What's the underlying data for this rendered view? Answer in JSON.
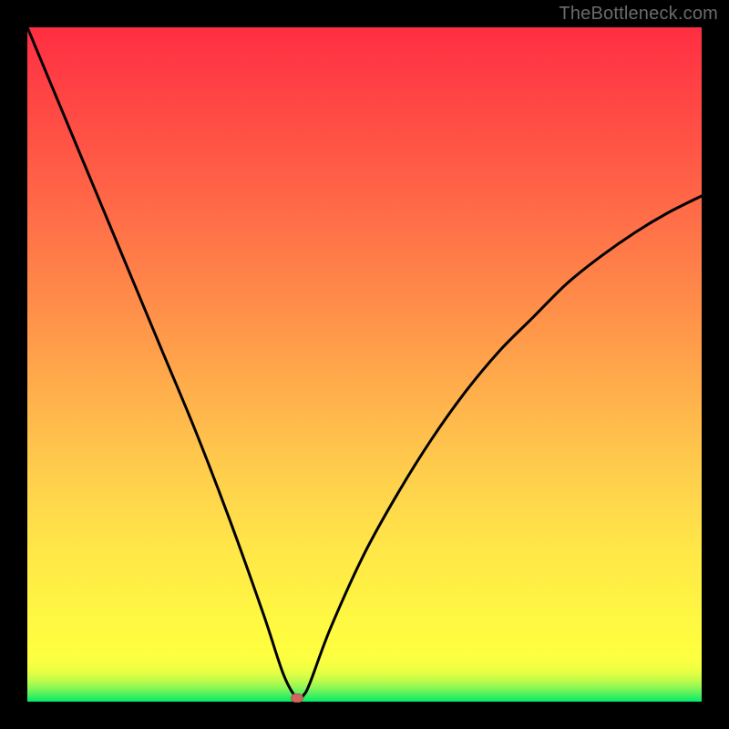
{
  "watermark": "TheBottleneck.com",
  "chart_data": {
    "type": "line",
    "title": "",
    "xlabel": "",
    "ylabel": "",
    "xlim": [
      0,
      100
    ],
    "ylim": [
      0,
      100
    ],
    "grid": false,
    "legend": false,
    "series": [
      {
        "name": "curve",
        "x": [
          0,
          5,
          10,
          15,
          20,
          25,
          30,
          35,
          38,
          40,
          41,
          42,
          45,
          50,
          55,
          60,
          65,
          70,
          75,
          80,
          85,
          90,
          95,
          100
        ],
        "y": [
          100,
          88,
          76,
          64,
          52,
          40,
          27,
          13,
          4,
          0.5,
          1,
          3,
          11,
          22,
          31,
          39,
          46,
          52,
          57,
          62,
          66,
          69.5,
          72.5,
          75
        ]
      }
    ],
    "marker": {
      "x": 40,
      "y": 0.5,
      "color": "#cf675f"
    },
    "gradient_stops": [
      {
        "pct": 0,
        "color": "#00eb68"
      },
      {
        "pct": 6,
        "color": "#faff41"
      },
      {
        "pct": 50,
        "color": "#ffad4b"
      },
      {
        "pct": 100,
        "color": "#ff2e42"
      }
    ]
  }
}
